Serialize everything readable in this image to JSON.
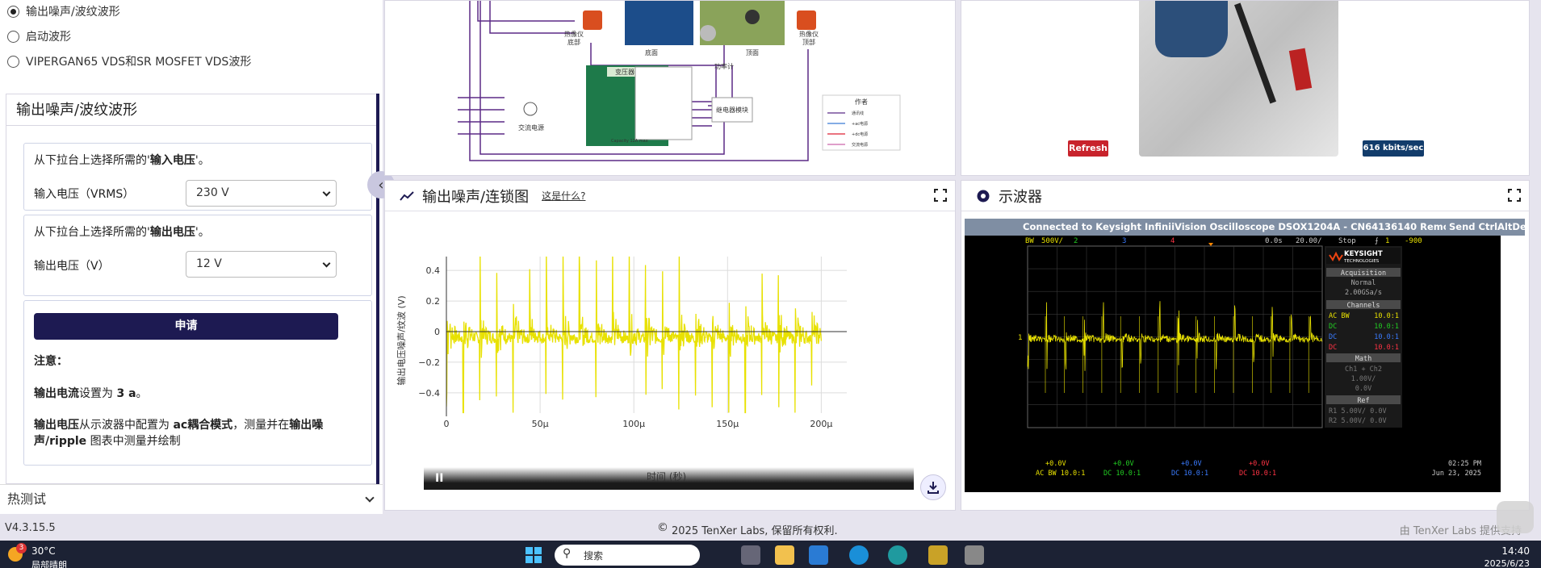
{
  "sidebar": {
    "radios": [
      {
        "label": "输出噪声/波纹波形",
        "checked": true
      },
      {
        "label": "启动波形",
        "checked": false
      },
      {
        "label": "VIPERGAN65 VDS和SR MOSFET VDS波形",
        "checked": false
      }
    ],
    "panel_title": "输出噪声/波纹波形",
    "input_card": {
      "prompt_pre": "从下拉台上选择所需的'",
      "prompt_bold": "输入电压",
      "prompt_post": "'。",
      "label": "输入电压（VRMS）",
      "value": "230 V"
    },
    "output_card": {
      "prompt_pre": "从下拉台上选择所需的'",
      "prompt_bold": "输出电压",
      "prompt_post": "'。",
      "label": "输出电压（V）",
      "value": "12 V"
    },
    "apply_label": "申请",
    "note_title": "注意：",
    "note1_bold1": "输出电流",
    "note1_mid": "设置为 ",
    "note1_bold2": "3 a",
    "note1_end": "。",
    "note2_bold1": "输出电压",
    "note2_mid": "从示波器中配置为 ",
    "note2_bold2": "ac耦合模式",
    "note2_mid2": "，测量并在",
    "note2_bold3": "输出噪声/ripple",
    "note2_end": " 图表中测量并绘制",
    "thermal_label": "热测试"
  },
  "diagram": {
    "labels": {
      "thermal_bottom": "热像仪\n底部",
      "bottom": "底面",
      "top": "顶面",
      "thermal_top": "热像仪\n顶部",
      "power_meter": "功率计",
      "transformer": "变压器",
      "relay": "继电器模块",
      "ac": "交流电源",
      "capacity": "Capacity 12A max"
    },
    "legend_title": "作者",
    "legend": [
      "通讯线",
      "+ac电源",
      "+dc电源",
      "交流电源"
    ]
  },
  "camera": {
    "refresh_label": "Refresh",
    "bitrate": "616 kbits/sec"
  },
  "chart_panel": {
    "title": "输出噪声/连锁图",
    "help_link": "这是什么?",
    "pause_label": "II"
  },
  "chart_data": {
    "type": "line",
    "title": "",
    "xlabel": "时间 (秒)",
    "ylabel": "输出电压噪声/纹波 (V)",
    "xlim": [
      0,
      0.000205
    ],
    "ylim": [
      -0.48,
      0.48
    ],
    "xticks": [
      {
        "v": 0,
        "label": "0"
      },
      {
        "v": 5e-05,
        "label": "50μ"
      },
      {
        "v": 0.0001,
        "label": "100μ"
      },
      {
        "v": 0.00015,
        "label": "150μ"
      },
      {
        "v": 0.0002,
        "label": "200μ"
      }
    ],
    "yticks": [
      {
        "v": 0.4,
        "label": "0.4"
      },
      {
        "v": 0.2,
        "label": "0.2"
      },
      {
        "v": 0,
        "label": "0"
      },
      {
        "v": -0.2,
        "label": "−0.2"
      },
      {
        "v": -0.4,
        "label": "−0.4"
      }
    ],
    "series": [
      {
        "color": "#e8e100",
        "spike_period_us": 8.85,
        "x_end": 0.0002,
        "amplitude": 0.5,
        "noise": 0.12
      }
    ],
    "grid": true
  },
  "scope_panel": {
    "title": "示波器"
  },
  "scope": {
    "banner": "Connected to Keysight InfiniiVision Oscilloscope DSOX1204A - CN64136140 Remote Front Panel",
    "send_label": "Send CtrlAltDel",
    "top_bar": {
      "bw": "BW",
      "ch1_scale": "500V/",
      "ch2": "2",
      "ch3": "3",
      "ch4": "4",
      "time_pos": "0.0s",
      "time_scale": "20.00/",
      "status": "Stop",
      "trig": "1",
      "trig_level": "-900"
    },
    "brand": "KEYSIGHT",
    "brand_sub": "TECHNOLOGIES",
    "acq": {
      "title": "Acquisition",
      "mode": "Normal",
      "rate": "2.00GSa/s"
    },
    "channels": {
      "title": "Channels",
      "rows": [
        {
          "c": "AC BW",
          "v": "10.0:1",
          "color": "#e8e100"
        },
        {
          "c": "DC",
          "v": "10.0:1",
          "color": "#22cc22"
        },
        {
          "c": "DC",
          "v": "10.0:1",
          "color": "#3a7bff"
        },
        {
          "c": "DC",
          "v": "10.0:1",
          "color": "#ff3344"
        }
      ]
    },
    "math": {
      "title": "Math",
      "lines": [
        "Ch1 + Ch2",
        "1.00V/",
        "0.0V"
      ]
    },
    "ref": {
      "title": "Ref",
      "lines": [
        "R1  5.00V/    0.0V",
        "R2  5.00V/    0.0V"
      ]
    },
    "bottom": {
      "ch": [
        "+0.0V",
        "+0.0V",
        "+0.0V",
        "+0.0V"
      ],
      "cpl": [
        "AC BW  10.0:1",
        "DC    10.0:1",
        "DC    10.0:1",
        "DC    10.0:1"
      ],
      "time": "02:25 PM",
      "date": "Jun 23, 2025"
    }
  },
  "footer": {
    "version": "V4.3.15.5",
    "copyright": "2025 TenXer Labs, 保留所有权利.",
    "right": "由 TenXer Labs 提供支持"
  },
  "taskbar": {
    "badge": "3",
    "temp": "30°C",
    "weather": "局部晴朗",
    "search": "搜索",
    "time": "14:40",
    "date": "2025/6/23"
  },
  "colors": {
    "accent": "#1d1a52",
    "refresh": "#c8232c",
    "bitrate": "#123c6b",
    "trace": "#e8e100"
  }
}
